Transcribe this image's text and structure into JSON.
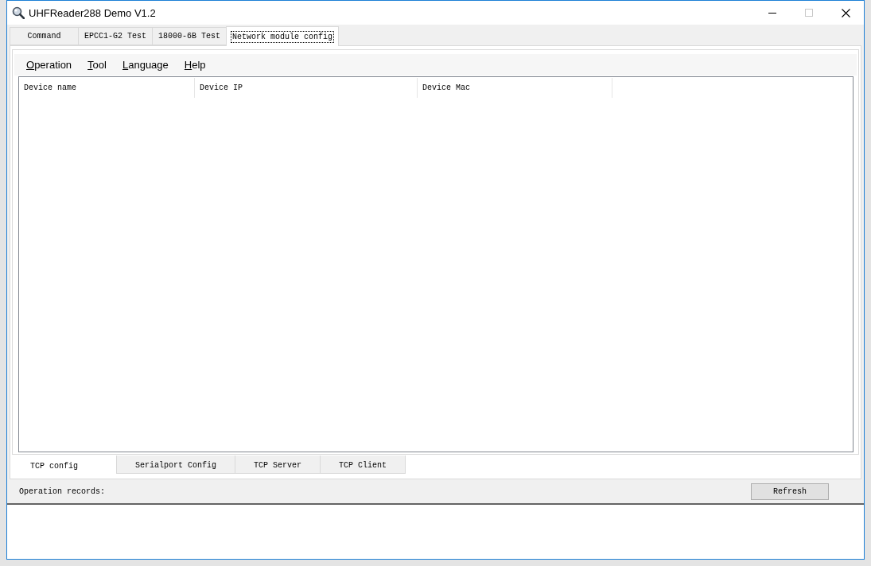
{
  "window": {
    "title": "UHFReader288 Demo V1.2"
  },
  "tabs": [
    {
      "label": "Command",
      "selected": false
    },
    {
      "label": "EPCC1-G2 Test",
      "selected": false
    },
    {
      "label": "18000-6B Test",
      "selected": false
    },
    {
      "label": "Network module config",
      "selected": true
    }
  ],
  "menu": [
    "Operation",
    "Tool",
    "Language",
    "Help"
  ],
  "device_table": {
    "columns": [
      "Device name",
      "Device IP",
      "Device Mac"
    ]
  },
  "bottom_tabs": [
    {
      "label": "TCP config",
      "selected": true
    },
    {
      "label": "Serialport Config",
      "selected": false
    },
    {
      "label": "TCP Server",
      "selected": false
    },
    {
      "label": "TCP Client",
      "selected": false
    }
  ],
  "records": {
    "label": "Operation records:"
  },
  "buttons": [
    "Refresh"
  ]
}
